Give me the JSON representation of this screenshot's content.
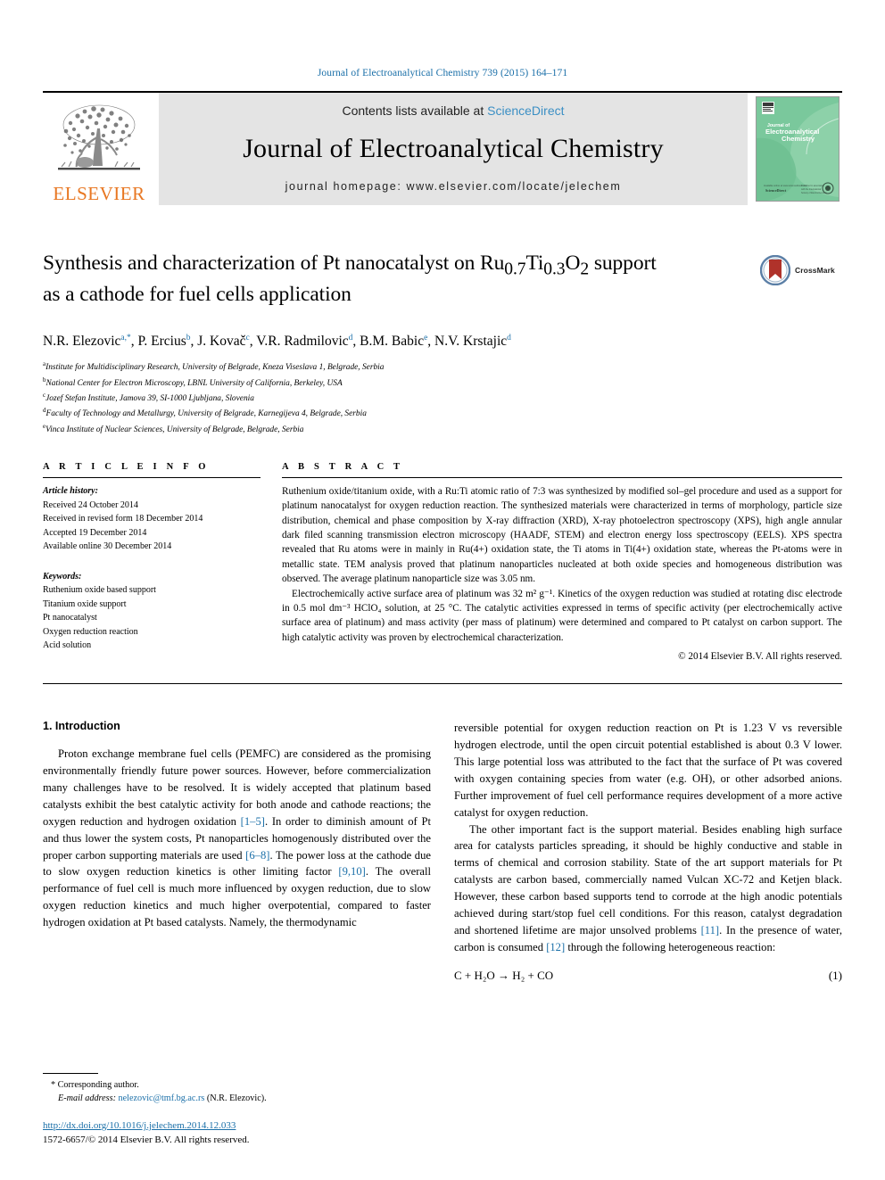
{
  "running_head": "Journal of Electroanalytical Chemistry 739 (2015) 164–171",
  "masthead": {
    "contents_prefix": "Contents lists available at ",
    "sciencedirect": "ScienceDirect",
    "journal_title": "Journal of Electroanalytical Chemistry",
    "homepage": "journal homepage: www.elsevier.com/locate/jelechem",
    "publisher_word": "ELSEVIER",
    "cover_line1": "Journal of",
    "cover_line2": "Electroanalytical",
    "cover_line3": "Chemistry",
    "cover_color": "#79c79a"
  },
  "article": {
    "title_line1": "Synthesis and characterization of Pt nanocatalyst on Ru",
    "title_sub1": "0.7",
    "title_mid": "Ti",
    "title_sub2": "0.3",
    "title_o": "O",
    "title_sub3": "2",
    "title_tail": " support",
    "title_line2": "as a cathode for fuel cells application",
    "crossmark_label": "CrossMark",
    "authors": [
      {
        "name": "N.R. Elezovic",
        "sup": "a,*"
      },
      {
        "name": "P. Ercius",
        "sup": "b"
      },
      {
        "name": "J. Kovač",
        "sup": "c"
      },
      {
        "name": "V.R. Radmilovic",
        "sup": "d"
      },
      {
        "name": "B.M. Babic",
        "sup": "e"
      },
      {
        "name": "N.V. Krstajic",
        "sup": "d"
      }
    ],
    "affiliations": [
      {
        "mark": "a",
        "text": "Institute for Multidisciplinary Research, University of Belgrade, Kneza Viseslava 1, Belgrade, Serbia"
      },
      {
        "mark": "b",
        "text": "National Center for Electron Microscopy, LBNL University of California, Berkeley, USA"
      },
      {
        "mark": "c",
        "text": "Jozef Stefan Institute, Jamova 39, SI-1000 Ljubljana, Slovenia"
      },
      {
        "mark": "d",
        "text": "Faculty of Technology and Metallurgy, University of Belgrade, Karnegijeva 4, Belgrade, Serbia"
      },
      {
        "mark": "e",
        "text": "Vinca Institute of Nuclear Sciences, University of Belgrade, Belgrade, Serbia"
      }
    ]
  },
  "article_info": {
    "heading": "A R T I C L E   I N F O",
    "history_label": "Article history:",
    "history": [
      "Received 24 October 2014",
      "Received in revised form 18 December 2014",
      "Accepted 19 December 2014",
      "Available online 30 December 2014"
    ],
    "keywords_label": "Keywords:",
    "keywords": [
      "Ruthenium oxide based support",
      "Titanium oxide support",
      "Pt nanocatalyst",
      "Oxygen reduction reaction",
      "Acid solution"
    ]
  },
  "abstract": {
    "heading": "A B S T R A C T",
    "paragraph1": "Ruthenium oxide/titanium oxide, with a Ru:Ti atomic ratio of 7:3 was synthesized by modified sol–gel procedure and used as a support for platinum nanocatalyst for oxygen reduction reaction. The synthesized materials were characterized in terms of morphology, particle size distribution, chemical and phase composition by X-ray diffraction (XRD), X-ray photoelectron spectroscopy (XPS), high angle annular dark filed scanning transmission electron microscopy (HAADF, STEM) and electron energy loss spectroscopy (EELS). XPS spectra revealed that Ru atoms were in mainly in Ru(4+) oxidation state, the Ti atoms in Ti(4+) oxidation state, whereas the Pt-atoms were in metallic state. TEM analysis proved that platinum nanoparticles nucleated at both oxide species and homogeneous distribution was observed. The average platinum nanoparticle size was 3.05 nm.",
    "paragraph2": "Electrochemically active surface area of platinum was 32 m² g⁻¹. Kinetics of the oxygen reduction was studied at rotating disc electrode in 0.5 mol dm⁻³ HClO₄ solution, at 25 °C. The catalytic activities expressed in terms of specific activity (per electrochemically active surface area of platinum) and mass activity (per mass of platinum) were determined and compared to Pt catalyst on carbon support. The high catalytic activity was proven by electrochemical characterization.",
    "copyright": "© 2014 Elsevier B.V. All rights reserved."
  },
  "body": {
    "section_heading": "1. Introduction",
    "left_para1_a": "Proton exchange membrane fuel cells (PEMFC) are considered as the promising environmentally friendly future power sources. However, before commercialization many challenges have to be resolved. It is widely accepted that platinum based catalysts exhibit the best catalytic activity for both anode and cathode reactions; the oxygen reduction and hydrogen oxidation ",
    "left_ref1": "[1–5]",
    "left_para1_b": ". In order to diminish amount of Pt and thus lower the system costs, Pt nanoparticles homogenously distributed over the proper carbon supporting materials are used ",
    "left_ref2": "[6–8]",
    "left_para1_c": ". The power loss at the cathode due to slow oxygen reduction kinetics is other limiting factor ",
    "left_ref3": "[9,10]",
    "left_para1_d": ". The overall performance of fuel cell is much more influenced by oxygen reduction, due to slow oxygen reduction kinetics and much higher overpotential, compared to faster hydrogen oxidation at Pt based catalysts. Namely, the thermodynamic",
    "right_para1": "reversible potential for oxygen reduction reaction on Pt is 1.23 V vs reversible hydrogen electrode, until the open circuit potential established is about 0.3 V lower. This large potential loss was attributed to the fact that the surface of Pt was covered with oxygen containing species from water (e.g. OH), or other adsorbed anions. Further improvement of fuel cell performance requires development of a more active catalyst for oxygen reduction.",
    "right_para2_a": "The other important fact is the support material. Besides enabling high surface area for catalysts particles spreading, it should be highly conductive and stable in terms of chemical and corrosion stability. State of the art support materials for Pt catalysts are carbon based, commercially named Vulcan XC-72 and Ketjen black. However, these carbon based supports tend to corrode at the high anodic potentials achieved during start/stop fuel cell conditions. For this reason, catalyst degradation and shortened lifetime are major unsolved problems ",
    "right_ref1": "[11]",
    "right_para2_b": ". In the presence of water, carbon is consumed ",
    "right_ref2": "[12]",
    "right_para2_c": " through the following heterogeneous reaction:",
    "equation_text": "C + H₂O → H₂ + CO",
    "equation_number": "(1)"
  },
  "footnote": {
    "corresponding": "* Corresponding author.",
    "email_label": "E-mail address:",
    "email": "nelezovic@tmf.bg.ac.rs",
    "email_owner": "(N.R. Elezovic).",
    "doi": "http://dx.doi.org/10.1016/j.jelechem.2014.12.033",
    "issn_line": "1572-6657/© 2014 Elsevier B.V. All rights reserved."
  },
  "colors": {
    "link": "#1a6fa8",
    "elsevier_orange": "#e87722",
    "sciencedirect": "#3b8fc4",
    "cover_green": "#79c79a",
    "crossmark_red": "#b0322a"
  }
}
